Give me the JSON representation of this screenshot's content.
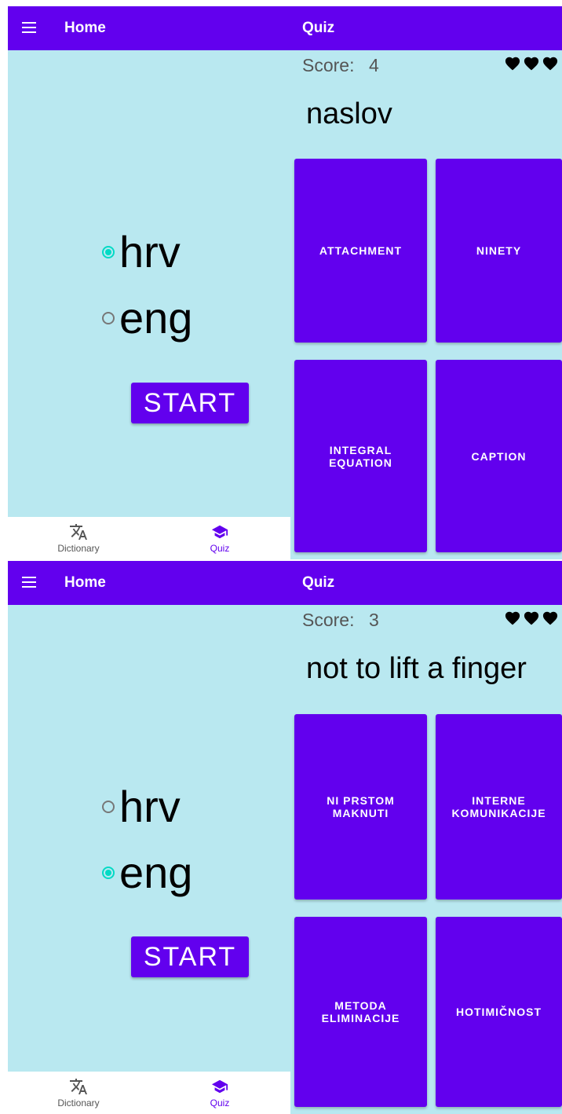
{
  "screens": [
    {
      "app_bar": {
        "home_title": "Home",
        "quiz_title": "Quiz"
      },
      "languages": [
        {
          "label": "hrv",
          "selected": true
        },
        {
          "label": "eng",
          "selected": false
        }
      ],
      "start_label": "START",
      "bottom_nav": {
        "dictionary_label": "Dictionary",
        "quiz_label": "Quiz"
      },
      "quiz": {
        "score_label": "Score:",
        "score_value": "4",
        "lives": 3,
        "word": "naslov",
        "answers": [
          {
            "label": "ATTACHMENT"
          },
          {
            "label": "NINETY"
          },
          {
            "label": "INTEGRAL EQUATION"
          },
          {
            "label": "CAPTION"
          }
        ]
      }
    },
    {
      "app_bar": {
        "home_title": "Home",
        "quiz_title": "Quiz"
      },
      "languages": [
        {
          "label": "hrv",
          "selected": false
        },
        {
          "label": "eng",
          "selected": true
        }
      ],
      "start_label": "START",
      "bottom_nav": {
        "dictionary_label": "Dictionary",
        "quiz_label": "Quiz"
      },
      "quiz": {
        "score_label": "Score:",
        "score_value": "3",
        "lives": 3,
        "word": "not to lift a finger",
        "answers": [
          {
            "label": "NI PRSTOM MAKNUTI"
          },
          {
            "label": "INTERNE KOMUNIKACIJE"
          },
          {
            "label": "METODA ELIMINACIJE"
          },
          {
            "label": "HOTIMIČNOST"
          }
        ]
      }
    }
  ],
  "colors": {
    "primary": "#6200ee",
    "accent": "#03dac5",
    "background": "#b9e8f0"
  },
  "icons": {
    "menu": "hamburger-icon",
    "dictionary": "translate-icon",
    "quiz": "graduation-cap-icon",
    "life": "heart-icon"
  }
}
